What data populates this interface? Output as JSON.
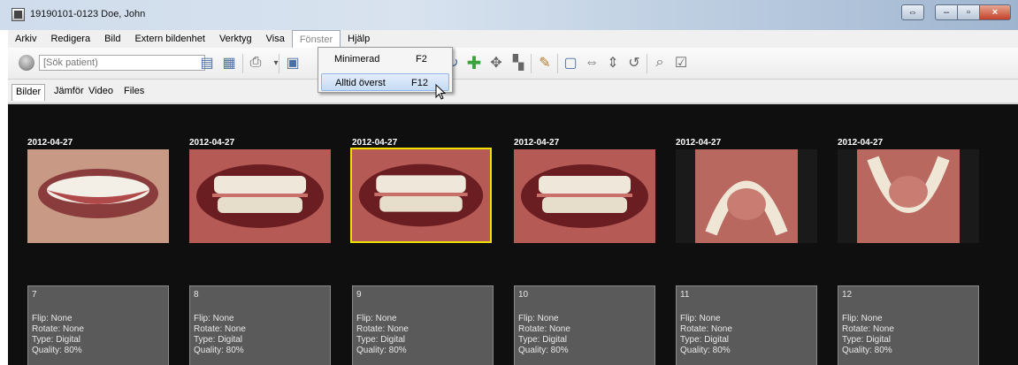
{
  "window": {
    "title": "19190101-0123 Doe, John"
  },
  "menu": [
    "Arkiv",
    "Redigera",
    "Bild",
    "Extern bildenhet",
    "Verktyg",
    "Visa",
    "Fönster",
    "Hjälp"
  ],
  "search": {
    "placeholder": "[Sök patient)"
  },
  "dropdown": [
    {
      "label": "Minimerad",
      "shortcut": "F2"
    },
    {
      "label": "Alltid överst",
      "shortcut": "F12"
    }
  ],
  "tabs": [
    "Bilder",
    "Jämför",
    "Video",
    "Files"
  ],
  "images": [
    {
      "date": "2012-04-27",
      "number": "7",
      "flip": "Flip: None",
      "rotate": "Rotate: None",
      "type": "Type: Digital",
      "quality": "Quality: 80%"
    },
    {
      "date": "2012-04-27",
      "number": "8",
      "flip": "Flip: None",
      "rotate": "Rotate: None",
      "type": "Type: Digital",
      "quality": "Quality: 80%"
    },
    {
      "date": "2012-04-27",
      "number": "9",
      "flip": "Flip: None",
      "rotate": "Rotate: None",
      "type": "Type: Digital",
      "quality": "Quality: 80%"
    },
    {
      "date": "2012-04-27",
      "number": "10",
      "flip": "Flip: None",
      "rotate": "Rotate: None",
      "type": "Type: Digital",
      "quality": "Quality: 80%"
    },
    {
      "date": "2012-04-27",
      "number": "11",
      "flip": "Flip: None",
      "rotate": "Rotate: None",
      "type": "Type: Digital",
      "quality": "Quality: 80%"
    },
    {
      "date": "2012-04-27",
      "number": "12",
      "flip": "Flip: None",
      "rotate": "Rotate: None",
      "type": "Type: Digital",
      "quality": "Quality: 80%"
    }
  ],
  "colors": {
    "gallery_bg": "#0f0f0f",
    "selection": "#f0e000",
    "info_bg": "#5a5a5a"
  }
}
